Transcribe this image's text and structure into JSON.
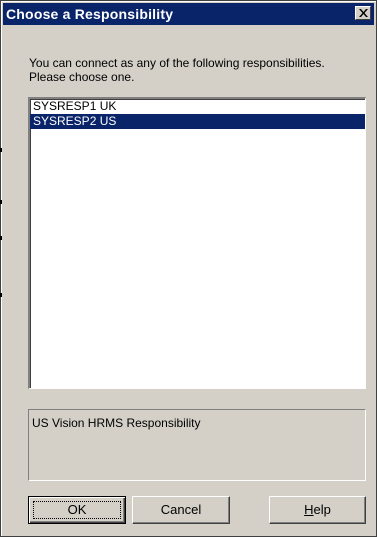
{
  "dialog": {
    "title": "Choose a Responsibility",
    "prompt_line1": "You can connect as any of the following responsibilities.",
    "prompt_line2": "Please choose one."
  },
  "responsibilities": {
    "items": [
      {
        "label": "SYSRESP1 UK",
        "selected": false
      },
      {
        "label": "SYSRESP2 US",
        "selected": true
      }
    ]
  },
  "description": {
    "text": "US Vision HRMS Responsibility"
  },
  "buttons": {
    "ok_label": "OK",
    "cancel_label": "Cancel",
    "help_mnemonic": "H",
    "help_rest": "elp"
  },
  "colors": {
    "title_bar": "#0a246a",
    "dialog_face": "#d4d0c8",
    "selection": "#0a246a"
  },
  "icons": {
    "close": "close-icon"
  }
}
